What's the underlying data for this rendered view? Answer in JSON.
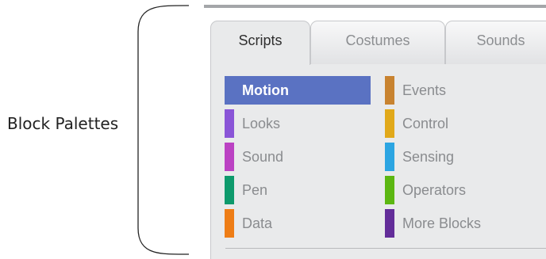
{
  "annotation": {
    "label": "Block Palettes"
  },
  "tabs": [
    {
      "label": "Scripts",
      "active": true
    },
    {
      "label": "Costumes",
      "active": false
    },
    {
      "label": "Sounds",
      "active": false
    }
  ],
  "categories": {
    "left": [
      {
        "label": "Motion",
        "color": "#4a6cd4",
        "selected": true
      },
      {
        "label": "Looks",
        "color": "#8a55d7",
        "selected": false
      },
      {
        "label": "Sound",
        "color": "#bb42c3",
        "selected": false
      },
      {
        "label": "Pen",
        "color": "#0e9a6c",
        "selected": false
      },
      {
        "label": "Data",
        "color": "#ee7d16",
        "selected": false
      }
    ],
    "right": [
      {
        "label": "Events",
        "color": "#c88330",
        "selected": false
      },
      {
        "label": "Control",
        "color": "#e1a91a",
        "selected": false
      },
      {
        "label": "Sensing",
        "color": "#2ca5e2",
        "selected": false
      },
      {
        "label": "Operators",
        "color": "#5cb712",
        "selected": false
      },
      {
        "label": "More Blocks",
        "color": "#632d99",
        "selected": false
      }
    ]
  }
}
